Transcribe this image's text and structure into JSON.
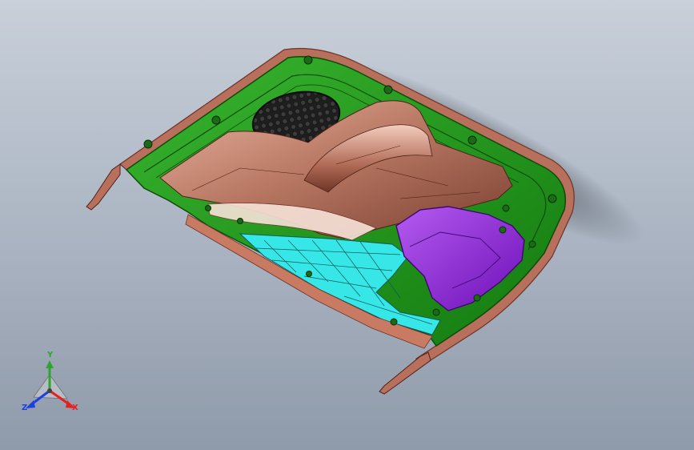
{
  "colors": {
    "background_top": "#c9d0da",
    "background_bottom": "#8f9aaa",
    "door_panel": "#1f9a19",
    "panel_edge": "#0d4d0a",
    "trim_copper": "#c97a63",
    "trim_rim": "#b86f5c",
    "armrest": "#b97964",
    "speaker_grille": "#2a2a2a",
    "switch_housing": "#8e1fd6",
    "mesh_cyan": "#37e6e6",
    "axis_x": "#e52020",
    "axis_y": "#2fa52f",
    "axis_z": "#1f3fe0"
  },
  "triad": {
    "x_label": "X",
    "y_label": "Y",
    "z_label": "Z"
  },
  "icons": {
    "triad": "coordinate-triad-icon"
  }
}
